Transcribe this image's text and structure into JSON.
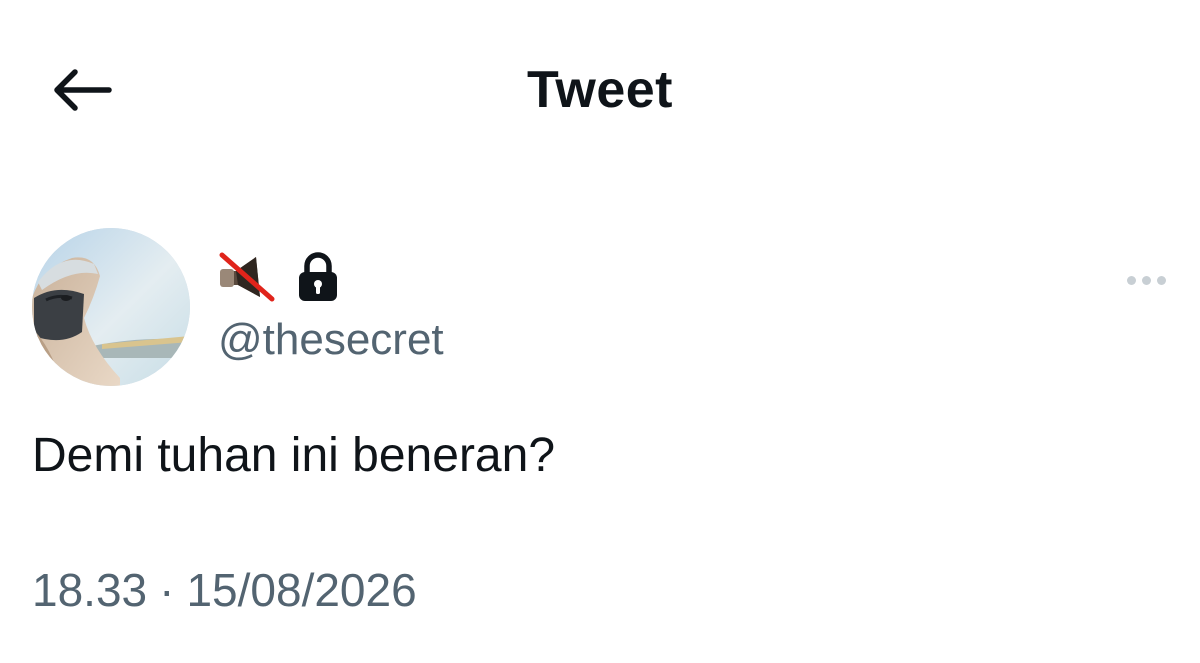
{
  "header": {
    "title": "Tweet",
    "back_icon": "arrow-left-icon"
  },
  "tweet": {
    "display_name_icons": [
      "muted-speaker-emoji-icon",
      "lock-icon"
    ],
    "handle": "@thesecret",
    "text": "Demi tuhan ini beneran?",
    "time": "18.33",
    "separator": "·",
    "date": "15/08/2026",
    "more_icon": "more-horizontal-icon"
  },
  "colors": {
    "text_primary": "#0f1419",
    "text_secondary": "#536471",
    "more_dots": "#c8cfd4"
  }
}
